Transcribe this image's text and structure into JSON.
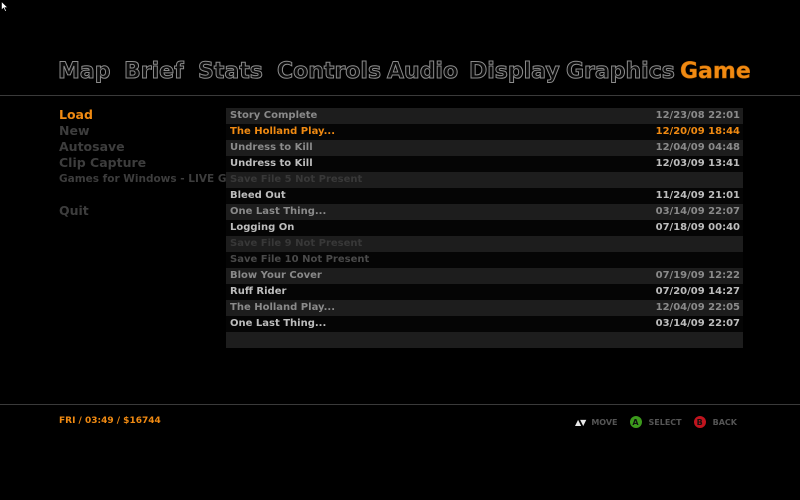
{
  "tabs": [
    {
      "label": "Map"
    },
    {
      "label": "Brief"
    },
    {
      "label": "Stats"
    },
    {
      "label": "Controls"
    },
    {
      "label": "Audio"
    },
    {
      "label": "Display"
    },
    {
      "label": "Graphics"
    },
    {
      "label": "Game",
      "active": true
    }
  ],
  "menu": {
    "items": [
      {
        "label": "Load",
        "active": true
      },
      {
        "label": "New"
      },
      {
        "label": "Autosave"
      },
      {
        "label": "Clip Capture"
      },
      {
        "label": "Games for Windows - LIVE Guide"
      },
      {
        "label": "Quit"
      }
    ]
  },
  "saves": [
    {
      "name": "Story Complete",
      "date": "12/23/08 22:01",
      "style": "mid"
    },
    {
      "name": "The Holland Play...",
      "date": "12/20/09 18:44",
      "style": "sel"
    },
    {
      "name": "Undress to Kill",
      "date": "12/04/09 04:48",
      "style": "mid"
    },
    {
      "name": "Undress to Kill",
      "date": "12/03/09 13:41",
      "style": "bright"
    },
    {
      "name": "Save File 5 Not Present",
      "date": "",
      "style": "dim"
    },
    {
      "name": "Bleed Out",
      "date": "11/24/09 21:01",
      "style": "bright"
    },
    {
      "name": "One Last Thing...",
      "date": "03/14/09 22:07",
      "style": "mid"
    },
    {
      "name": "Logging On",
      "date": "07/18/09 00:40",
      "style": "bright"
    },
    {
      "name": "Save File 9 Not Present",
      "date": "",
      "style": "dim"
    },
    {
      "name": "Save File 10 Not Present",
      "date": "",
      "style": "empty"
    },
    {
      "name": "Blow Your Cover",
      "date": "07/19/09 12:22",
      "style": "mid"
    },
    {
      "name": "Ruff Rider",
      "date": "07/20/09 14:27",
      "style": "bright"
    },
    {
      "name": "The Holland Play...",
      "date": "12/04/09 22:05",
      "style": "mid"
    },
    {
      "name": "One Last Thing...",
      "date": "03/14/09 22:07",
      "style": "bright"
    }
  ],
  "status": {
    "text": "FRI  /  03:49  /  $16744"
  },
  "hints": {
    "move_label": "MOVE",
    "select_label": "SELECT",
    "back_label": "BACK",
    "a_glyph": "A",
    "b_glyph": "B",
    "a_color": "#3c9a1c",
    "b_color": "#c0141e"
  },
  "colors": {
    "accent": "#f08a12"
  }
}
